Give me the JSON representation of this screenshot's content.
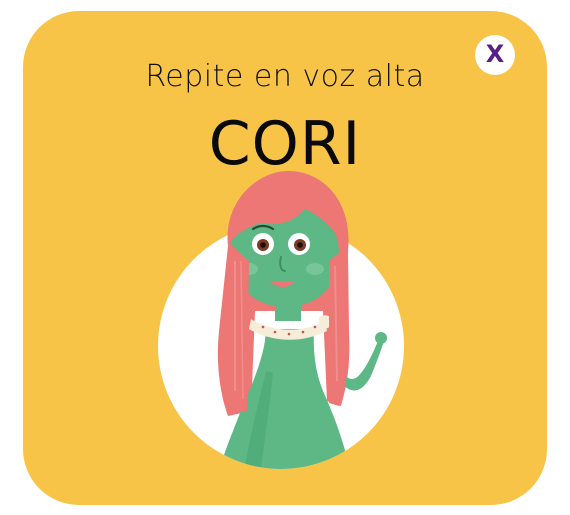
{
  "dialog": {
    "instruction": "Repite en voz alta",
    "word": "CORI",
    "close_label": "X"
  },
  "illustration": {
    "icon": "girl-character-illustration"
  },
  "colors": {
    "card_background": "#f8c448",
    "close_icon": "#5a1f87",
    "skin": "#5db886",
    "hair": "#ec7774"
  }
}
